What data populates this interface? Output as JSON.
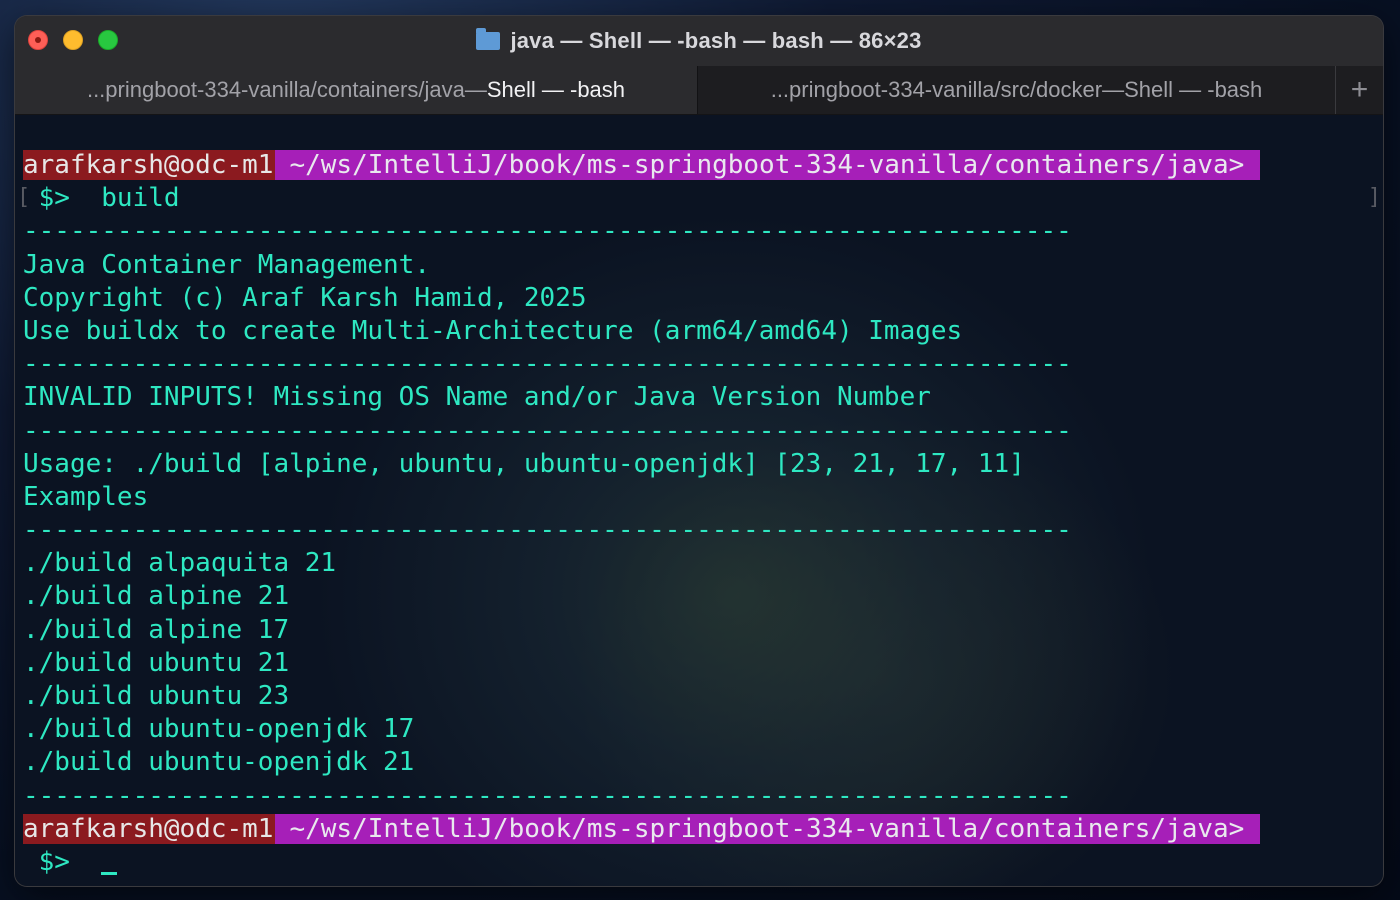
{
  "window": {
    "title": "java — Shell — -bash — bash — 86×23",
    "folder_icon": "folder-icon"
  },
  "tabs": [
    {
      "path": "...pringboot-334-vanilla/containers/java",
      "sep": " — ",
      "name": "Shell — -bash",
      "active": true
    },
    {
      "path": "...pringboot-334-vanilla/src/docker",
      "sep": " — ",
      "name": "Shell — -bash",
      "active": false
    }
  ],
  "tab_add_label": "+",
  "terminal": {
    "prompt1": {
      "user": "arafkarsh@odc-m1",
      "path": "~/ws/IntelliJ/book/ms-springboot-334-vanilla/containers/java>"
    },
    "command1": {
      "dollar": " $>",
      "cmd": "  build"
    },
    "divider": "-------------------------------------------------------------------",
    "header_lines": [
      "Java Container Management.",
      "Copyright (c) Araf Karsh Hamid, 2025",
      "Use buildx to create Multi-Architecture (arm64/amd64) Images"
    ],
    "error_line": "INVALID INPUTS! Missing OS Name and/or Java Version Number",
    "usage_line": "Usage: ./build [alpine, ubuntu, ubuntu-openjdk] [23, 21, 17, 11]",
    "examples_label": "Examples",
    "examples": [
      "./build alpaquita 21",
      "./build alpine 21",
      "./build alpine 17",
      "./build ubuntu 21",
      "./build ubuntu 23",
      "./build ubuntu-openjdk 17",
      "./build ubuntu-openjdk 21"
    ],
    "prompt2": {
      "user": "arafkarsh@odc-m1",
      "path": "~/ws/IntelliJ/book/ms-springboot-334-vanilla/containers/java>"
    },
    "command2": {
      "dollar": " $>",
      "cmd": "  "
    },
    "bracket_left": "[",
    "bracket_right": "]"
  }
}
